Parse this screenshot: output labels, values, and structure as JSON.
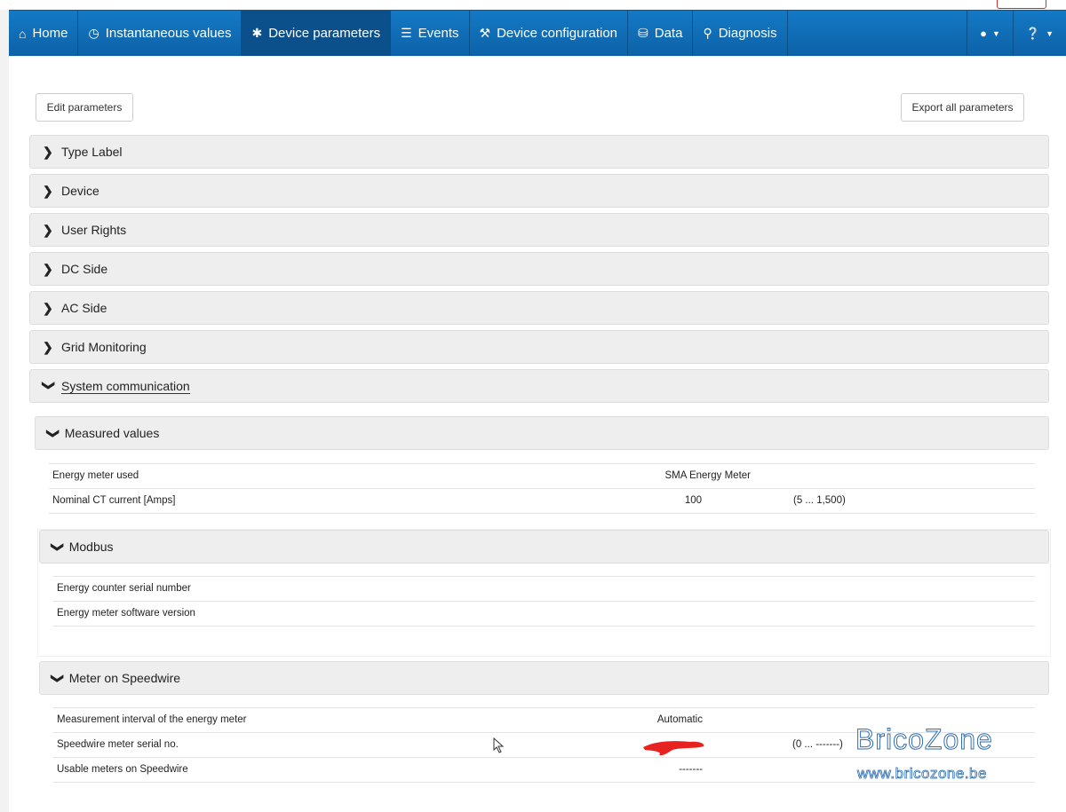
{
  "nav": {
    "items": [
      {
        "label": "Home",
        "icon": "home-icon"
      },
      {
        "label": "Instantaneous values",
        "icon": "clock-icon"
      },
      {
        "label": "Device parameters",
        "icon": "gear-icon",
        "active": true
      },
      {
        "label": "Events",
        "icon": "list-icon"
      },
      {
        "label": "Device configuration",
        "icon": "wrench-icon"
      },
      {
        "label": "Data",
        "icon": "database-icon"
      },
      {
        "label": "Diagnosis",
        "icon": "search-icon"
      }
    ]
  },
  "toolbar": {
    "edit_label": "Edit parameters",
    "export_label": "Export all parameters"
  },
  "groups": [
    {
      "label": "Type Label",
      "expanded": false
    },
    {
      "label": "Device",
      "expanded": false
    },
    {
      "label": "User Rights",
      "expanded": false
    },
    {
      "label": "DC Side",
      "expanded": false
    },
    {
      "label": "AC Side",
      "expanded": false
    },
    {
      "label": "Grid Monitoring",
      "expanded": false
    },
    {
      "label": "System communication",
      "expanded": true
    }
  ],
  "measured": {
    "title": "Measured values",
    "rows": [
      {
        "label": "Energy meter used",
        "value": "SMA Energy Meter",
        "range": ""
      },
      {
        "label": "Nominal CT current [Amps]",
        "value": "100",
        "range": "(5 ... 1,500)"
      }
    ]
  },
  "modbus": {
    "title": "Modbus",
    "rows": [
      {
        "label": "Energy counter serial number",
        "value": ""
      },
      {
        "label": "Energy meter software version",
        "value": ""
      }
    ]
  },
  "speedwire": {
    "title": "Meter on Speedwire",
    "rows": [
      {
        "label": "Measurement interval of the energy meter",
        "value": "Automatic",
        "range": ""
      },
      {
        "label": "Speedwire meter serial no.",
        "value": "",
        "range": "(0 ... -------)"
      },
      {
        "label": "Usable meters on Speedwire",
        "value": "-------",
        "range": ""
      }
    ]
  },
  "watermark": {
    "brand": "BricoZone",
    "url": "www.bricozone.be"
  },
  "colors": {
    "nav_bg": "#1479c4",
    "nav_active": "#0b4f8b",
    "panel_bg": "#eeeeee"
  }
}
